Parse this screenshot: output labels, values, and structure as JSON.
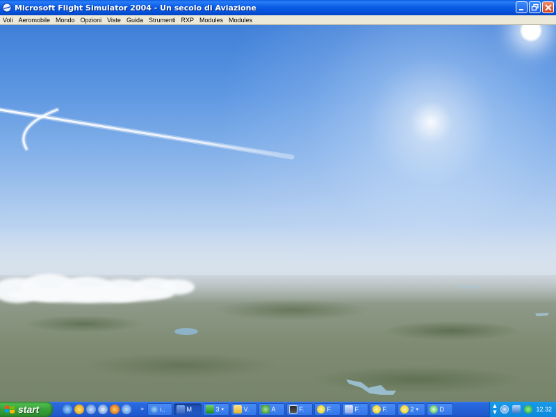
{
  "window": {
    "title": "Microsoft Flight Simulator 2004 - Un secolo di Aviazione",
    "app_icon": "flight-sim-icon",
    "controls": [
      "minimize-icon",
      "restore-icon",
      "close-icon"
    ]
  },
  "menubar": {
    "items": [
      "Voli",
      "Aeromobile",
      "Mondo",
      "Opzioni",
      "Viste",
      "Guida",
      "Strumenti",
      "RXP",
      "Modules",
      "Modules"
    ]
  },
  "scene": {
    "sky_top_color": "#3f7fd8",
    "horizon_color": "#dde7f0",
    "ground_color": "#7f8c73"
  },
  "taskbar": {
    "start_label": "start",
    "quicklaunch_icons": [
      "ie-icon",
      "media-player-icon",
      "messenger-icon",
      "outlook-icon",
      "firefox-icon",
      "search-icon"
    ],
    "quicklaunch_more": "»",
    "tasks": [
      {
        "label": "i..",
        "icon": "ie-icon",
        "active": false,
        "arrow": false
      },
      {
        "label": "M",
        "icon": "flight-sim-icon",
        "active": true,
        "arrow": false
      },
      {
        "label": "3",
        "icon": "excel-icon",
        "active": false,
        "arrow": true
      },
      {
        "label": "V.",
        "icon": "folder-icon",
        "active": false,
        "arrow": false
      },
      {
        "label": "A",
        "icon": "puzzle-icon",
        "active": false,
        "arrow": false
      },
      {
        "label": "F.",
        "icon": "monitor-icon",
        "active": false,
        "arrow": false
      },
      {
        "label": "F.",
        "icon": "sun-icon",
        "active": false,
        "arrow": false
      },
      {
        "label": "F.",
        "icon": "plane-icon",
        "active": false,
        "arrow": false
      },
      {
        "label": "F.",
        "icon": "sun-icon",
        "active": false,
        "arrow": false
      },
      {
        "label": "2",
        "icon": "sun-icon",
        "active": false,
        "arrow": true
      },
      {
        "label": "D",
        "icon": "network-icon",
        "active": false,
        "arrow": false
      }
    ],
    "tray": {
      "scroll_up": "▲",
      "scroll_down": "▼",
      "icons": [
        "collapse-tray-icon",
        "network-tray-icon",
        "user-tray-icon"
      ],
      "clock": "12.32"
    }
  }
}
